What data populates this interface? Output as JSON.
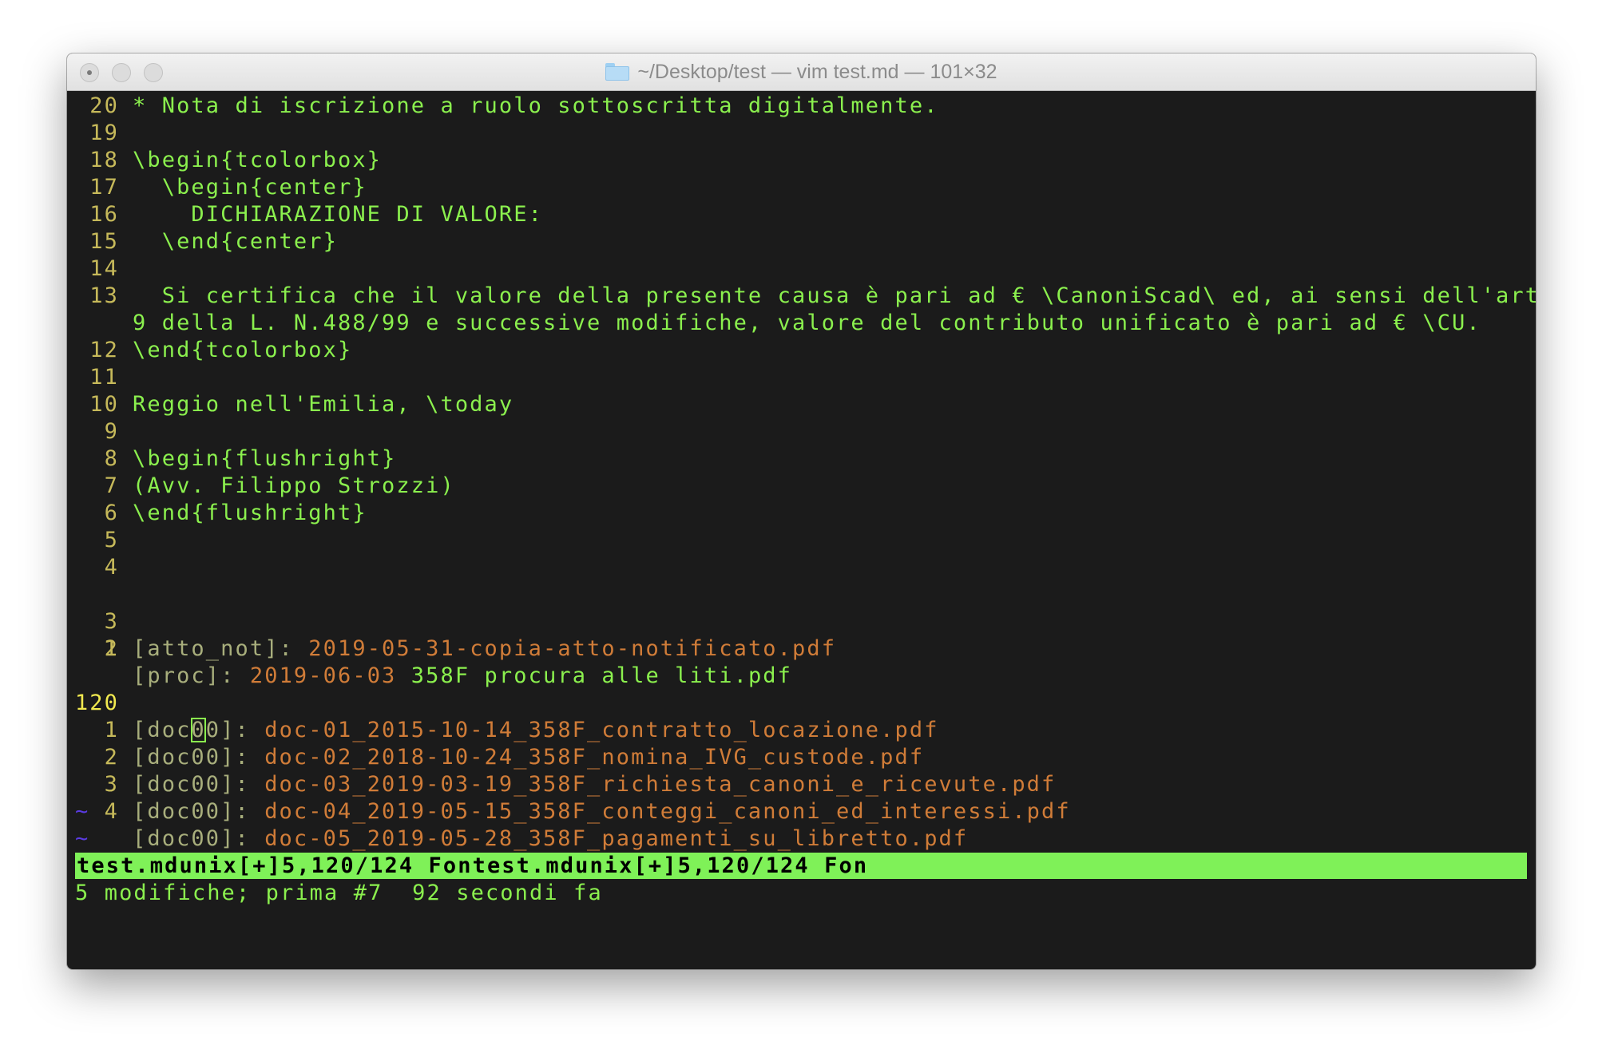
{
  "window": {
    "title": "~/Desktop/test — vim test.md — 101×32"
  },
  "lines": [
    {
      "num": "20",
      "text": "* Nota di iscrizione a ruolo sottoscritta digitalmente."
    },
    {
      "num": "19",
      "text": ""
    },
    {
      "num": "18",
      "text": "\\begin{tcolorbox}"
    },
    {
      "num": "17",
      "text": "  \\begin{center}"
    },
    {
      "num": "16",
      "text": "    DICHIARAZIONE DI VALORE:"
    },
    {
      "num": "15",
      "text": "  \\end{center}"
    },
    {
      "num": "14",
      "text": ""
    },
    {
      "num": "13",
      "text": "  Si certifica che il valore della presente causa è pari ad € \\CanoniScad\\ ed, ai sensi dell'art."
    },
    {
      "num": "",
      "text": "9 della L. N.488/99 e successive modifiche, valore del contributo unificato è pari ad € \\CU."
    },
    {
      "num": "12",
      "text": "\\end{tcolorbox}"
    },
    {
      "num": "11",
      "text": ""
    },
    {
      "num": "10",
      "text": "Reggio nell'Emilia, \\today"
    },
    {
      "num": "9",
      "text": ""
    },
    {
      "num": "8",
      "text": "\\begin{flushright}"
    },
    {
      "num": "7",
      "text": "(Avv. Filippo Strozzi)"
    },
    {
      "num": "6",
      "text": "\\end{flushright}"
    },
    {
      "num": "5",
      "text": ""
    },
    {
      "num": "4",
      "text": ""
    }
  ],
  "refs": {
    "line3": {
      "num": "3",
      "label": "[atto_not]:",
      "file": "2019-05-31-copia-atto-notificato.pdf"
    },
    "line2": {
      "num": "2",
      "label": "[proc]:",
      "date": "2019-06-03",
      "rest": "358F procura alle liti.pdf"
    },
    "line1": {
      "num": "1"
    }
  },
  "current_line": {
    "num": "120",
    "label_before": "[doc",
    "cursor_char": "0",
    "label_after": "0]:",
    "file": "doc-01_2015-10-14_358F_contratto_locazione.pdf"
  },
  "doc_lines": [
    {
      "num": "1",
      "label": "[doc00]:",
      "file": "doc-02_2018-10-24_358F_nomina_IVG_custode.pdf"
    },
    {
      "num": "2",
      "label": "[doc00]:",
      "file": "doc-03_2019-03-19_358F_richiesta_canoni_e_ricevute.pdf"
    },
    {
      "num": "3",
      "label": "[doc00]:",
      "file": "doc-04_2019-05-15_358F_conteggi_canoni_ed_interessi.pdf"
    },
    {
      "num": "4",
      "label": "[doc00]:",
      "file": "doc-05_2019-05-28_358F_pagamenti_su_libretto.pdf"
    }
  ],
  "tildes": [
    "~",
    "~"
  ],
  "statusline": "test.mdunix[+]5,120/124 Fontest.mdunix[+]5,120/124 Fon",
  "cmdline": "5 modifiche; prima #7  92 secondi fa",
  "colors": {
    "background": "#1b1b1b",
    "text_green": "#8bf04e",
    "link_orange": "#d07c38",
    "line_number": "#c6b95a",
    "current_line_number": "#f1e94f",
    "statusline_bg": "#7ff158",
    "tilde": "#5a3be0"
  }
}
